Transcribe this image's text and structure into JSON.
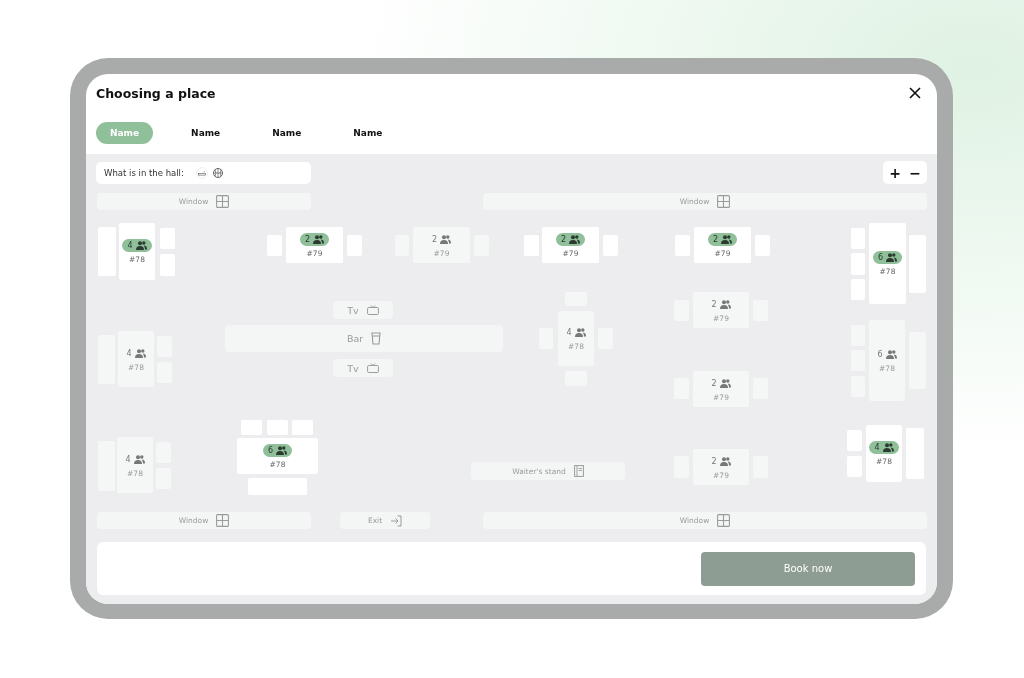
{
  "window": {
    "title": "Choosing a place"
  },
  "tabs": [
    {
      "label": "Name",
      "selected": true
    },
    {
      "label": "Name",
      "selected": false
    },
    {
      "label": "Name",
      "selected": false
    },
    {
      "label": "Name",
      "selected": false
    }
  ],
  "hall_legend": {
    "label": "What is in the hall:"
  },
  "zoom": {
    "zoom_in": "+",
    "zoom_out": "−"
  },
  "landmarks": [
    {
      "kind": "window",
      "label": "Window"
    },
    {
      "kind": "window",
      "label": "Window"
    },
    {
      "kind": "tv",
      "label": "Tv"
    },
    {
      "kind": "bar",
      "label": "Bar"
    },
    {
      "kind": "tv",
      "label": "Tv"
    },
    {
      "kind": "stand",
      "label": "Waiter's stand"
    },
    {
      "kind": "window",
      "label": "Window"
    },
    {
      "kind": "exit",
      "label": "Exit"
    },
    {
      "kind": "window",
      "label": "Window"
    }
  ],
  "tables": [
    {
      "seats": "4",
      "number": "#78",
      "available": true
    },
    {
      "seats": "2",
      "number": "#79",
      "available": true
    },
    {
      "seats": "2",
      "number": "#79",
      "available": false
    },
    {
      "seats": "2",
      "number": "#79",
      "available": true
    },
    {
      "seats": "2",
      "number": "#79",
      "available": true
    },
    {
      "seats": "6",
      "number": "#78",
      "available": true
    },
    {
      "seats": "4",
      "number": "#78",
      "available": false
    },
    {
      "seats": "4",
      "number": "#78",
      "available": false
    },
    {
      "seats": "2",
      "number": "#79",
      "available": false
    },
    {
      "seats": "6",
      "number": "#78",
      "available": false
    },
    {
      "seats": "2",
      "number": "#79",
      "available": false
    },
    {
      "seats": "6",
      "number": "#78",
      "available": true
    },
    {
      "seats": "4",
      "number": "#78",
      "available": false
    },
    {
      "seats": "2",
      "number": "#79",
      "available": false
    },
    {
      "seats": "4",
      "number": "#78",
      "available": true
    }
  ],
  "book_button": {
    "label": "Book now"
  }
}
